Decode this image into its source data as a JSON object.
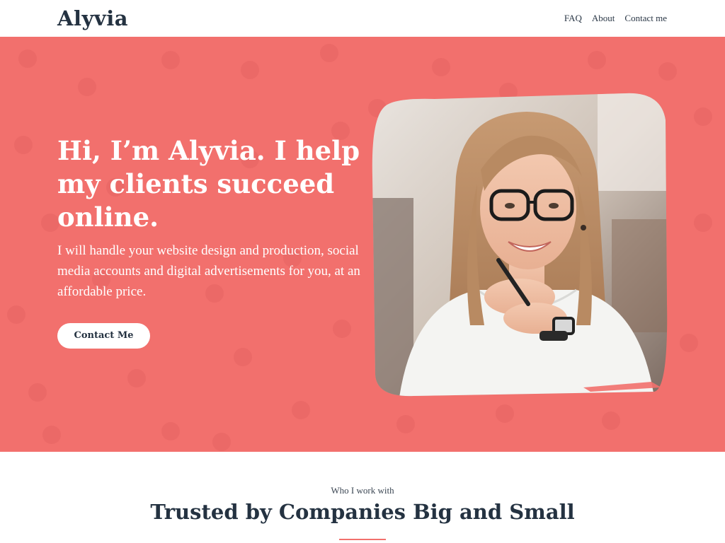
{
  "header": {
    "logo": "Alyvia",
    "nav": [
      {
        "label": "FAQ"
      },
      {
        "label": "About"
      },
      {
        "label": "Contact me"
      }
    ]
  },
  "hero": {
    "title": "Hi, I’m Alyvia. I help my clients succeed online.",
    "text": "I will handle your website design and production, social media accounts and digital advertisements for you, at an affordable price.",
    "cta_label": "Contact Me",
    "background_color": "#f2706d"
  },
  "section": {
    "eyebrow": "Who I work with",
    "title": "Trusted by Companies Big and Small"
  }
}
